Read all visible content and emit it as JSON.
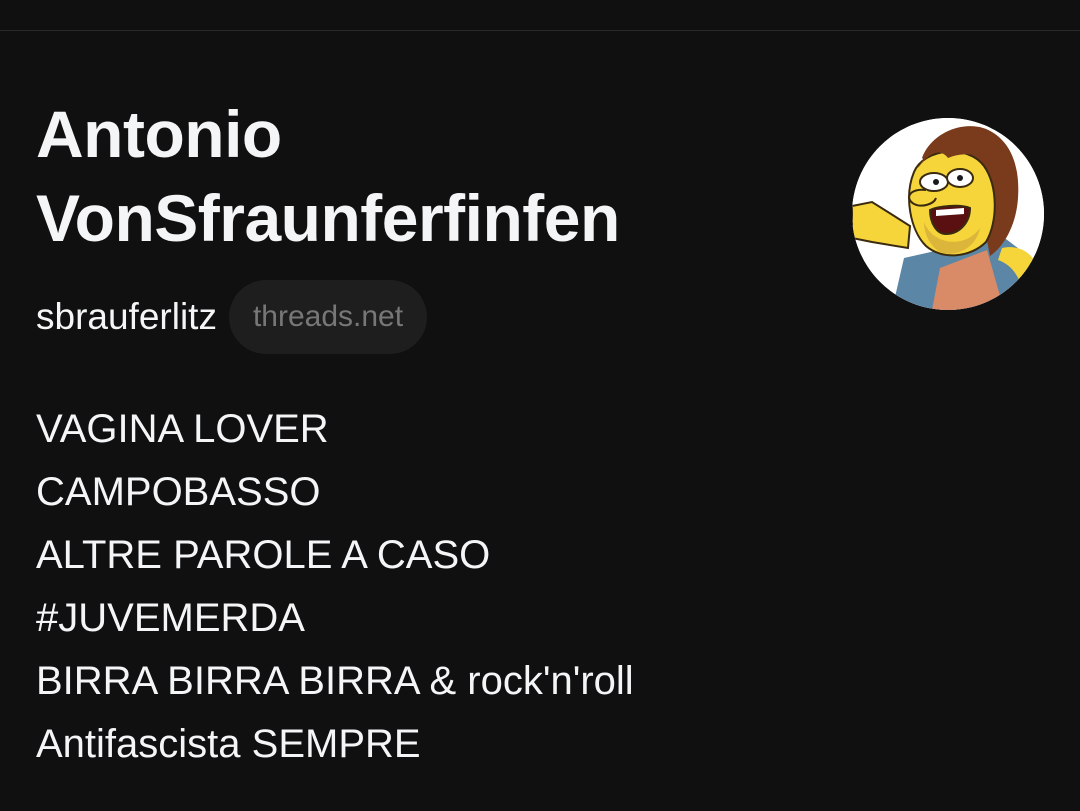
{
  "profile": {
    "name_line1": "Antonio",
    "name_line2": "VonSfraunferfinfen",
    "username": "sbrauferlitz",
    "domain": "threads.net",
    "avatar_icon": "cartoon-avatar-icon",
    "bio": [
      "VAGINA LOVER",
      "CAMPOBASSO",
      "ALTRE PAROLE A CASO",
      "#JUVEMERDA",
      "BIRRA BIRRA BIRRA & rock'n'roll",
      "Antifascista SEMPRE"
    ]
  },
  "colors": {
    "background": "#101010",
    "text_primary": "#f3f5f7",
    "text_secondary": "#777777",
    "chip_background": "#1e1e1e"
  }
}
